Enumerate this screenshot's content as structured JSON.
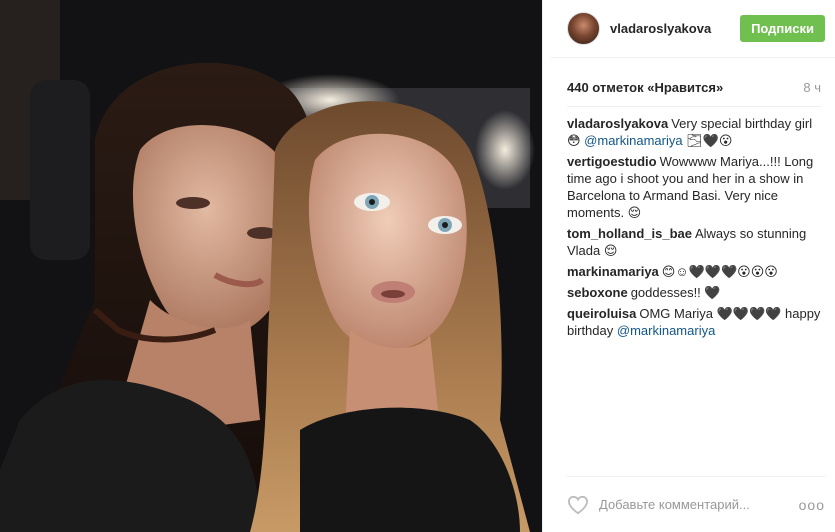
{
  "post": {
    "author": "vladaroslyakova",
    "follow_label": "Подписки",
    "likes": "440 отметок «Нравится»",
    "time": "8 ч",
    "comments": [
      {
        "user": "vladaroslyakova",
        "text": "Very special birthday girl 😳 ",
        "mention": "@markinamariya",
        "tail": " 🌫🖤😮"
      },
      {
        "user": "vertigoestudio",
        "text": "Wowwww Mariya...!!! Long time ago i shoot you and her in a show in Barcelona to Armand Basi. Very nice moments. 😌",
        "mention": "",
        "tail": ""
      },
      {
        "user": "tom_holland_is_bae",
        "text": "Always so stunning Vlada 😌",
        "mention": "",
        "tail": ""
      },
      {
        "user": "markinamariya",
        "text": "😊☺🖤🖤🖤😮😮😮",
        "mention": "",
        "tail": ""
      },
      {
        "user": "seboxone",
        "text": "goddesses!! 🖤",
        "mention": "",
        "tail": ""
      },
      {
        "user": "queiroluisa",
        "text": "OMG Mariya 🖤🖤🖤🖤 happy birthday ",
        "mention": "@markinamariya",
        "tail": ""
      }
    ],
    "add_comment_placeholder": "Добавьте комментарий...",
    "more_label": "ooo"
  },
  "icons": {
    "like": "heart-outline-icon",
    "more": "more-options-icon"
  },
  "colors": {
    "follow_button": "#70c050",
    "mention": "#125688",
    "username": "#262626",
    "muted": "#999999"
  }
}
